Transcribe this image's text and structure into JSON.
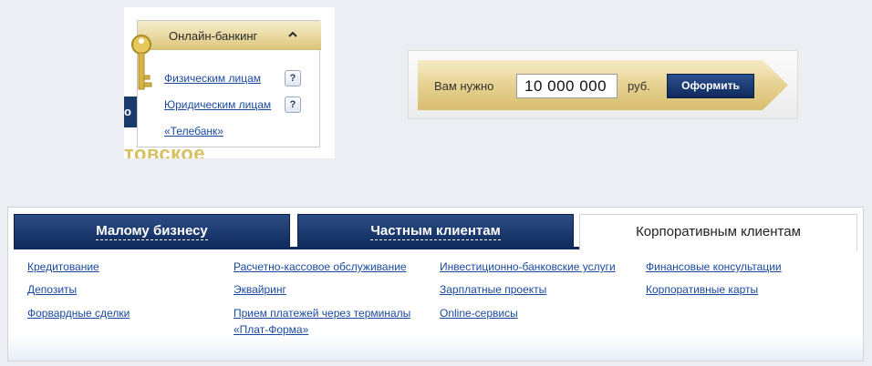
{
  "online_banking": {
    "background_text": "товское",
    "background_box_text": "о",
    "header_label": "Онлайн-банкинг",
    "chevron_icon": "chevron-up-icon",
    "key_icon": "key-icon",
    "links": [
      {
        "label": "Физическим лицам",
        "help": "?"
      },
      {
        "label": "Юридическим лицам",
        "help": "?"
      },
      {
        "label": "«Телебанк»"
      }
    ]
  },
  "loan": {
    "label": "Вам нужно",
    "amount_value": "10 000 000",
    "unit": "руб.",
    "button_label": "Оформить"
  },
  "tabs": {
    "items": [
      {
        "label": "Малому бизнесу"
      },
      {
        "label": "Частным клиентам"
      },
      {
        "label": "Корпоративным клиентам",
        "active": true
      }
    ],
    "columns": [
      [
        "Кредитование",
        "Депозиты",
        "Форвардные сделки"
      ],
      [
        "Расчетно-кассовое обслуживание",
        "Эквайринг",
        "Прием платежей через терминалы «Плат-Форма»"
      ],
      [
        "Инвестиционно-банковские услуги",
        "Зарплатные проекты",
        "Online-сервисы"
      ],
      [
        "Финансовые консультации",
        "Корпоративные карты"
      ]
    ],
    "line_break_parts": [
      "Прием платежей через терминалы",
      "«Плат-Форма»"
    ]
  },
  "colors": {
    "link": "#1a4aa0",
    "tab_dark": "#0f2a5c",
    "gold": "#dcc67c",
    "page_bg": "#eceef4"
  }
}
